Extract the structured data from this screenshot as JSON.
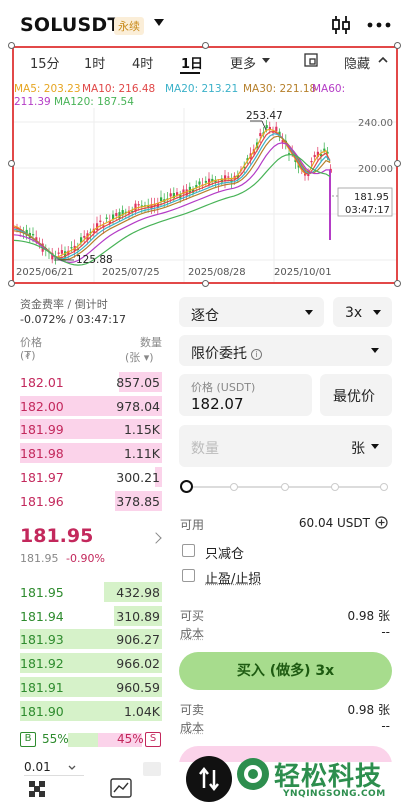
{
  "header": {
    "symbol": "SOLUSDT",
    "perp_badge": "永续",
    "icons": [
      "chevron-down-icon",
      "candlestick-icon",
      "more-icon"
    ]
  },
  "chart": {
    "timeframes": [
      "15分",
      "1时",
      "4时",
      "1日",
      "更多"
    ],
    "active_timeframe": "1日",
    "hide_label": "隐藏",
    "ma": {
      "ma5": "MA5: 203.23",
      "ma10": "MA10: 216.48",
      "ma20": "MA20: 213.21",
      "ma30": "MA30: 221.18",
      "ma60": "MA60:",
      "ma60_value": "211.39",
      "ma120": "MA120: 187.54"
    },
    "y_ticks": [
      "240.00",
      "200.00"
    ],
    "x_ticks": [
      "2025/06/21",
      "2025/07/25",
      "2025/08/28",
      "2025/10/01"
    ],
    "high_label": "253.47",
    "low_label": "125.88",
    "current_price_box": "181.95",
    "countdown_box": "03:47:17",
    "colors": {
      "up": "#2fae45",
      "down": "#e0335f",
      "ma5": "#e6a521",
      "ma10": "#e04747",
      "ma20": "#3bb1c9",
      "ma30": "#b6802c",
      "ma60": "#b43cc6",
      "ma120": "#48b357"
    },
    "chart_data": {
      "type": "line",
      "x": [
        "2025/06/21",
        "2025/07/25",
        "2025/08/28",
        "2025/10/01"
      ],
      "series": [
        {
          "name": "MA5",
          "values": [
            203.23
          ]
        },
        {
          "name": "MA10",
          "values": [
            216.48
          ]
        },
        {
          "name": "MA20",
          "values": [
            213.21
          ]
        },
        {
          "name": "MA30",
          "values": [
            221.18
          ]
        },
        {
          "name": "MA60",
          "values": [
            211.39
          ]
        },
        {
          "name": "MA120",
          "values": [
            187.54
          ]
        }
      ],
      "ylim": [
        120,
        260
      ]
    }
  },
  "funding": {
    "label": "资金费率 / 倒计时",
    "value": "-0.072% / 03:47:17"
  },
  "orderbook": {
    "price_header": "价格",
    "price_unit": "(₮)",
    "qty_header": "数量",
    "qty_unit": "(张 ▾)",
    "asks": [
      {
        "price": "182.01",
        "qty": "857.05",
        "depth": 0.3
      },
      {
        "price": "182.00",
        "qty": "978.04",
        "depth": 1.0
      },
      {
        "price": "181.99",
        "qty": "1.15K",
        "depth": 1.0
      },
      {
        "price": "181.98",
        "qty": "1.11K",
        "depth": 1.0
      },
      {
        "price": "181.97",
        "qty": "300.21",
        "depth": 0.05
      },
      {
        "price": "181.96",
        "qty": "378.85",
        "depth": 0.33
      }
    ],
    "last_price": "181.95",
    "last_sub": "181.95",
    "last_change": "-0.90%",
    "bids": [
      {
        "price": "181.95",
        "qty": "432.98",
        "depth": 0.41
      },
      {
        "price": "181.94",
        "qty": "310.89",
        "depth": 0.34
      },
      {
        "price": "181.93",
        "qty": "906.27",
        "depth": 1.0
      },
      {
        "price": "181.92",
        "qty": "966.02",
        "depth": 1.0
      },
      {
        "price": "181.91",
        "qty": "960.59",
        "depth": 1.0
      },
      {
        "price": "181.90",
        "qty": "1.04K",
        "depth": 1.0
      }
    ],
    "buy_ratio": "55%",
    "sell_ratio": "45%",
    "buy_letter": "B",
    "sell_letter": "S",
    "precision": "0.01"
  },
  "order_form": {
    "margin_mode": "逐仓",
    "leverage": "3x",
    "order_type": "限价委托",
    "price_label": "价格 (USDT)",
    "price_value": "182.07",
    "best_price": "最优价",
    "qty_placeholder": "数量",
    "qty_unit": "张",
    "available_label": "可用",
    "available_value": "60.04 USDT",
    "reduce_only": "只减仓",
    "tp_sl": "止盈/止损",
    "can_buy_label": "可买",
    "can_buy_value": "0.98 张",
    "cost_label": "成本",
    "cost_value": "--",
    "buy_button": "买入 (做多) 3x",
    "can_sell_label": "可卖",
    "can_sell_value": "0.98 张",
    "cost2_label": "成本",
    "cost2_value": "--"
  },
  "brand": {
    "name": "轻松科技",
    "url": "YNQINGSONG.COM"
  }
}
